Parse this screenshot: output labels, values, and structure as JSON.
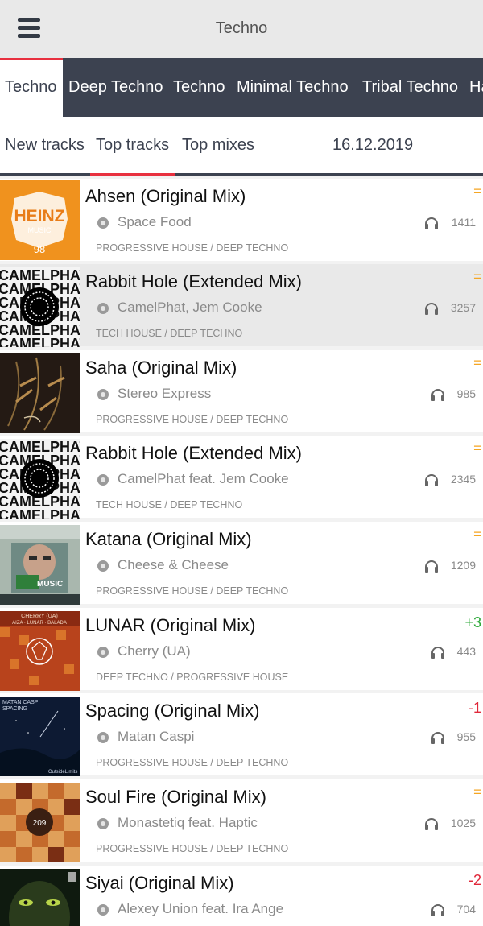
{
  "header": {
    "title": "Techno"
  },
  "genre_tabs": [
    "Techno",
    "Deep Techno",
    "Techno",
    "Minimal Techno",
    "Tribal Techno",
    "Ha"
  ],
  "sub_tabs": [
    "New tracks",
    "Top tracks",
    "Top mixes"
  ],
  "date": "16.12.2019",
  "tracks": [
    {
      "title": "Ahsen (Original Mix)",
      "artist": "Space Food",
      "genres": "PROGRESSIVE HOUSE / DEEP TECHNO",
      "plays": "1411",
      "change": "="
    },
    {
      "title": "Rabbit Hole (Extended Mix)",
      "artist": "CamelPhat, Jem Cooke",
      "genres": "TECH HOUSE / DEEP TECHNO",
      "plays": "3257",
      "change": "="
    },
    {
      "title": "Saha (Original Mix)",
      "artist": "Stereo Express",
      "genres": "PROGRESSIVE HOUSE / DEEP TECHNO",
      "plays": "985",
      "change": "="
    },
    {
      "title": "Rabbit Hole (Extended Mix)",
      "artist": "CamelPhat feat. Jem Cooke",
      "genres": "TECH HOUSE / DEEP TECHNO",
      "plays": "2345",
      "change": "="
    },
    {
      "title": "Katana (Original Mix)",
      "artist": "Cheese & Cheese",
      "genres": "PROGRESSIVE HOUSE / DEEP TECHNO",
      "plays": "1209",
      "change": "="
    },
    {
      "title": "LUNAR (Original Mix)",
      "artist": "Cherry (UA)",
      "genres": "DEEP TECHNO / PROGRESSIVE HOUSE",
      "plays": "443",
      "change": "+3"
    },
    {
      "title": "Spacing (Original Mix)",
      "artist": "Matan Caspi",
      "genres": "PROGRESSIVE HOUSE / DEEP TECHNO",
      "plays": "955",
      "change": "-1"
    },
    {
      "title": "Soul Fire (Original Mix)",
      "artist": "Monastetiq feat. Haptic",
      "genres": "PROGRESSIVE HOUSE / DEEP TECHNO",
      "plays": "1025",
      "change": "="
    },
    {
      "title": "Siyai (Original Mix)",
      "artist": "Alexey Union feat. Ira Ange",
      "genres": "",
      "plays": "704",
      "change": "-2"
    }
  ],
  "covers": {
    "heinz": {
      "line1": "HEINZ",
      "line2": "MUSIC",
      "number": "98"
    },
    "camelphat": {
      "lines": [
        "CAMELPHAT",
        "CAMELPHAT",
        "CAMELPHAT",
        "CAMELPHAT",
        "CAMELPHAT",
        "CAMELPHAT"
      ]
    },
    "katana": {
      "label": "MUSIC"
    },
    "lunar": {
      "line1": "CHERRY (UA)",
      "line2": "AIZA · LUNAR · BALADA"
    },
    "spacing": {
      "line1": "MATAN CASPI",
      "line2": "SPACING",
      "footer": "OutsideLimits"
    },
    "soulfire": {
      "number": "209"
    }
  },
  "colors": {
    "accent": "#e8303f",
    "bar": "#3c4250",
    "equal": "#f5a623",
    "up": "#2eaa3a",
    "down": "#e0283a"
  }
}
